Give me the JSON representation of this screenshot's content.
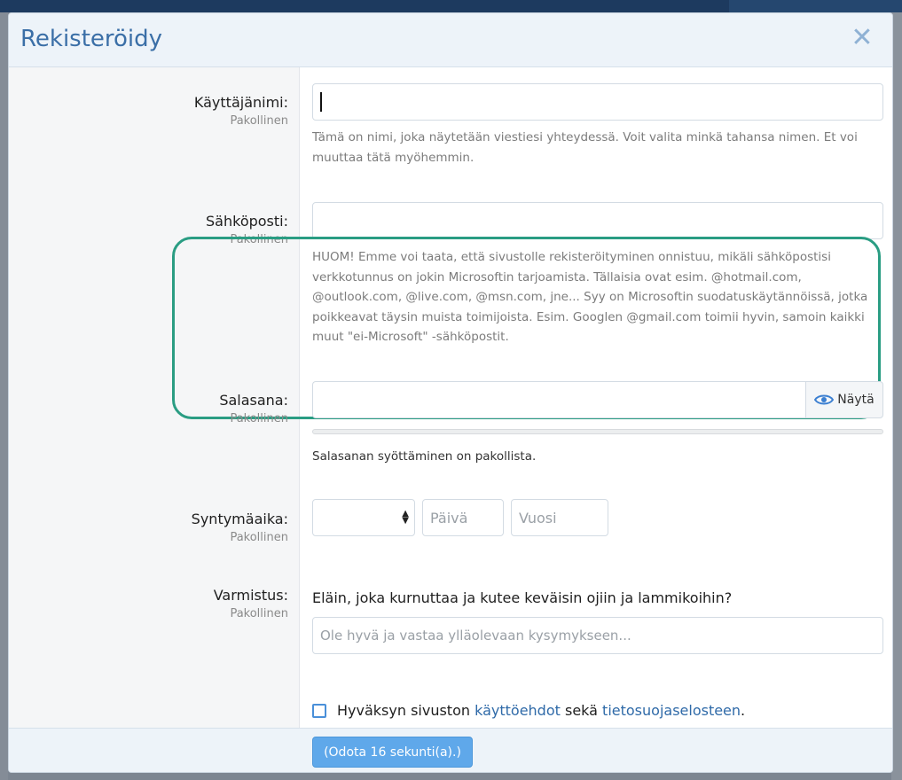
{
  "modal": {
    "title": "Rekisteröidy",
    "close_icon": "close-icon"
  },
  "required_label": "Pakollinen",
  "username": {
    "label": "Käyttäjänimi:",
    "value": "",
    "hint": "Tämä on nimi, joka näytetään viestiesi yhteydessä. Voit valita minkä tahansa nimen. Et voi muuttaa tätä myöhemmin."
  },
  "email": {
    "label": "Sähköposti:",
    "value": "",
    "hint": "HUOM! Emme voi taata, että sivustolle rekisteröityminen onnistuu, mikäli sähköpostisi verkkotunnus on jokin Microsoftin tarjoamista. Tällaisia ovat esim. @hotmail.com, @outlook.com, @live.com, @msn.com, jne... Syy on Microsoftin suodatuskäytännöissä, jotka poikkeavat täysin muista toimijoista. Esim. Googlen @gmail.com toimii hyvin, samoin kaikki muut \"ei-Microsoft\" -sähköpostit."
  },
  "password": {
    "label": "Salasana:",
    "show_label": "Näytä",
    "show_icon": "eye-icon",
    "message": "Salasanan syöttäminen on pakollista."
  },
  "dob": {
    "label": "Syntymäaika:",
    "day_placeholder": "Päivä",
    "year_placeholder": "Vuosi"
  },
  "verification": {
    "label": "Varmistus:",
    "question": "Eläin, joka kurnuttaa ja kutee keväisin ojiin ja lammikoihin?",
    "placeholder": "Ole hyvä ja vastaa ylläolevaan kysymykseen..."
  },
  "terms": {
    "prefix": "Hyväksyn sivuston",
    "link1": "käyttöehdot",
    "middle": "sekä",
    "link2": "tietosuojaselosteen",
    "suffix": "."
  },
  "footer": {
    "submit_label": "(Odota 16 sekunti(a).)"
  },
  "colors": {
    "accent": "#3b6fa7",
    "highlight": "#2a9d83",
    "button": "#5fa8ea"
  }
}
